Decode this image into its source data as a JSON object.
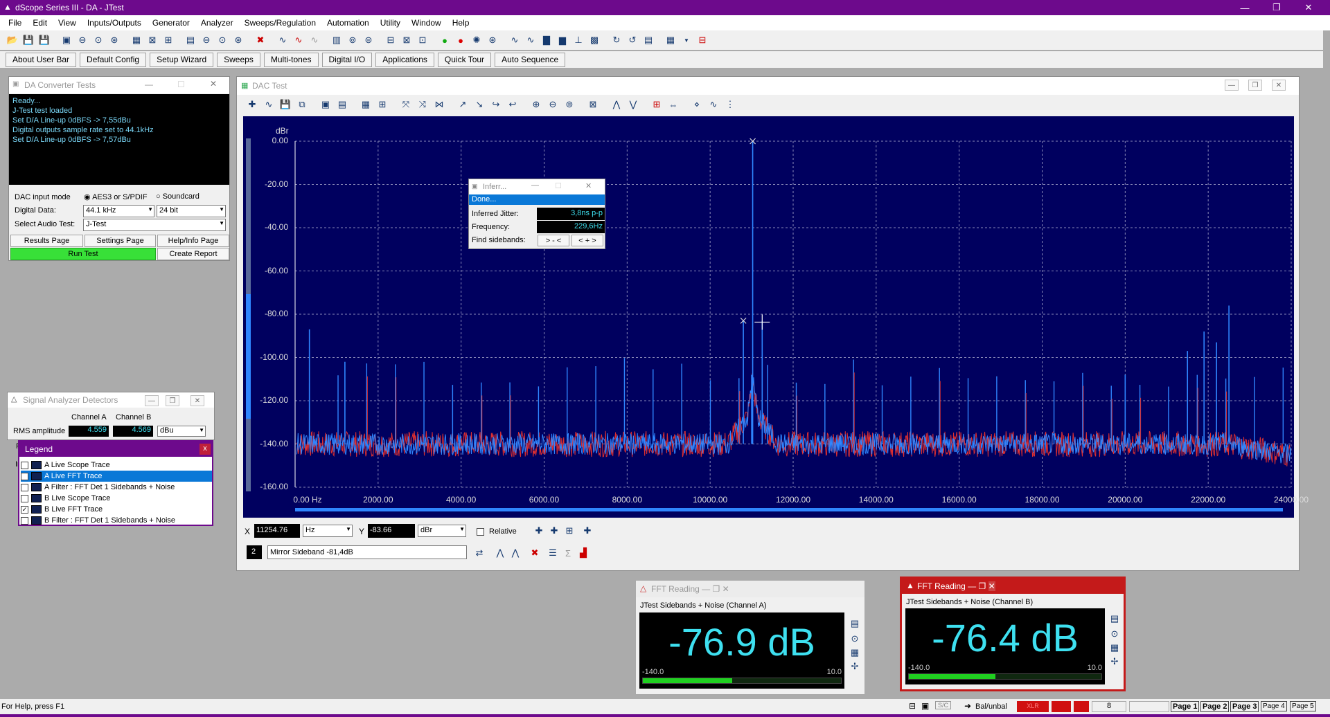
{
  "app": {
    "title": "dScope Series III - DA - JTest"
  },
  "menu": [
    "File",
    "Edit",
    "View",
    "Inputs/Outputs",
    "Generator",
    "Analyzer",
    "Sweeps/Regulation",
    "Automation",
    "Utility",
    "Window",
    "Help"
  ],
  "userbar": [
    "About User Bar",
    "Default Config",
    "Setup Wizard",
    "Sweeps",
    "Multi-tones",
    "Digital I/O",
    "Applications",
    "Quick Tour",
    "Auto Sequence"
  ],
  "da_window": {
    "title": "DA Converter Tests",
    "log": [
      "Ready...",
      "J-Test test loaded",
      "Set D/A Line-up 0dBFS -> 7,55dBu",
      "Digital outputs sample rate set to 44.1kHz",
      "Set D/A Line-up 0dBFS -> 7,57dBu"
    ],
    "input_mode_label": "DAC input mode",
    "radio_aes": "AES3 or S/PDIF",
    "radio_soundcard": "Soundcard",
    "digital_data_label": "Digital Data:",
    "sample_rate": "44.1 kHz",
    "bit_depth": "24 bit",
    "select_test_label": "Select Audio Test:",
    "test": "J-Test",
    "buttons": {
      "results": "Results Page",
      "settings": "Settings Page",
      "help": "Help/Info Page",
      "run": "Run Test",
      "report": "Create Report"
    }
  },
  "detectors": {
    "title": "Signal Analyzer Detectors",
    "channel_a": "Channel A",
    "channel_b": "Channel B",
    "row_label": "RMS amplitude",
    "value_a": "4.559",
    "value_b": "4.569",
    "unit": "dBu",
    "cut_label_1": "F",
    "cut_label_2": "Ir"
  },
  "legend": {
    "title": "Legend",
    "close": "x",
    "items": [
      {
        "label": "A Live Scope Trace",
        "checked": false
      },
      {
        "label": "A Live FFT Trace",
        "checked": true
      },
      {
        "label": "A Filter : FFT Det 1 Sidebands + Noise",
        "checked": false
      },
      {
        "label": "B Live Scope Trace",
        "checked": false
      },
      {
        "label": "B Live FFT Trace",
        "checked": true
      },
      {
        "label": "B Filter : FFT Det 1 Sidebands + Noise",
        "checked": false
      }
    ]
  },
  "dac_test": {
    "title": "DAC Test",
    "x_label": "X",
    "x_value": "11254.76",
    "x_unit": "Hz",
    "y_label": "Y",
    "y_value": "-83.66",
    "y_unit": "dBr",
    "relative_label": "Relative",
    "marker_num": "2",
    "marker_text": "Mirror Sideband -81,4dB"
  },
  "inferred": {
    "title": "Inferr...",
    "done": "Done...",
    "jitter_label": "Inferred Jitter:",
    "jitter_value": "3,8ns p-p",
    "freq_label": "Frequency:",
    "freq_value": "229,6Hz",
    "sidebands_label": "Find sidebands:",
    "btn1": "> - <",
    "btn2": "< + >"
  },
  "chart_data": {
    "type": "line",
    "ylabel": "dBr",
    "xlim": [
      0,
      24000
    ],
    "ylim": [
      -160,
      0
    ],
    "y_ticks": [
      "0.00",
      "-20.00",
      "-40.00",
      "-60.00",
      "-80.00",
      "-100.00",
      "-120.00",
      "-140.00",
      "-160.00"
    ],
    "x_ticks": [
      "0.00 Hz",
      "2000.00",
      "4000.00",
      "6000.00",
      "8000.00",
      "10000.00",
      "12000.00",
      "14000.00",
      "16000.00",
      "18000.00",
      "20000.00",
      "22000.00",
      "24000.00"
    ],
    "grid": true,
    "noise_floor_dbr": -140,
    "series": [
      {
        "name": "A Live FFT Trace",
        "color": "#2f86ff",
        "peaks": [
          [
            11025,
            0
          ],
          [
            10800,
            -83
          ],
          [
            11254,
            -83
          ],
          [
            11000,
            -108
          ],
          [
            345,
            -87
          ],
          [
            1200,
            -102
          ],
          [
            22500,
            -76
          ],
          [
            21900,
            -88
          ],
          [
            21500,
            -97
          ],
          [
            22200,
            -93
          ],
          [
            20000,
            -108
          ]
        ]
      },
      {
        "name": "B Live FFT Trace",
        "color": "#e03030",
        "peaks": [
          [
            11025,
            0
          ]
        ]
      }
    ]
  },
  "fft_a": {
    "title": "FFT Reading",
    "subtitle": "JTest Sidebands + Noise  (Channel A)",
    "value": "-76.9 dB",
    "min": "-140.0",
    "max": "10.0",
    "fill": 0.45
  },
  "fft_b": {
    "title": "FFT Reading",
    "subtitle": "JTest Sidebands + Noise (Channel B)",
    "value": "-76.4 dB",
    "min": "-140.0",
    "max": "10.0",
    "fill": 0.45
  },
  "status": {
    "help": "For Help, press F1",
    "balunbal": "Bal/unbal",
    "xlr": "XLR",
    "num": "8",
    "pages": [
      "Page 1",
      "Page 2",
      "Page 3",
      "Page 4",
      "Page 5"
    ]
  },
  "colors": {
    "title_bar": "#6d0a8c",
    "plot_bg": "#00005f",
    "trace_a": "#2f86ff",
    "trace_b": "#e03030",
    "meter_text": "#3ee0f0"
  }
}
